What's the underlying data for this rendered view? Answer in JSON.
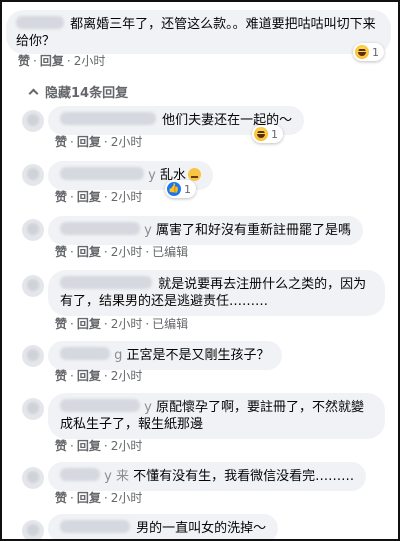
{
  "top_comment": {
    "text": "都离婚三年了，还管这么款。。难道要把咕咕叫切下来给你？",
    "actions": {
      "like": "赞",
      "reply": "回复",
      "time": "2小时"
    },
    "reaction_count": "1"
  },
  "hide_replies_label": "隐藏14条回复",
  "replies": [
    {
      "text": "他们夫妻还在一起的～",
      "like": "赞",
      "reply": "回复",
      "time": "2小时",
      "reaction_count": "1",
      "reaction": "haha"
    },
    {
      "name_tail": "y",
      "text": "乱水",
      "like": "赞",
      "reply": "回复",
      "time": "2小时",
      "reaction_count": "1",
      "reaction": "like"
    },
    {
      "name_tail": "y",
      "text": "厲害了和好沒有重新註冊罷了是嗎",
      "like": "赞",
      "reply": "回复",
      "time": "2小时",
      "edited": "已编辑"
    },
    {
      "text": "就是说要再去注册什么之类的，因为有了，结果男的还是逃避责任………",
      "like": "赞",
      "reply": "回复",
      "time": "2小时",
      "edited": "已编辑"
    },
    {
      "name_tail": "g",
      "text": "正宮是不是又剛生孩子？",
      "like": "赞",
      "reply": "回复",
      "time": "2小时"
    },
    {
      "name_tail": "y",
      "text": "原配懷孕了啊，要註冊了，不然就變成私生子了，報生紙那邊",
      "like": "赞",
      "reply": "回复",
      "time": "2小时"
    },
    {
      "name_tail": "y 来",
      "text": "不懂有没有生，我看微信没看完………",
      "like": "赞",
      "reply": "回复",
      "time": "2小时"
    },
    {
      "text": "男的一直叫女的洗掉～"
    }
  ],
  "separator": "·"
}
